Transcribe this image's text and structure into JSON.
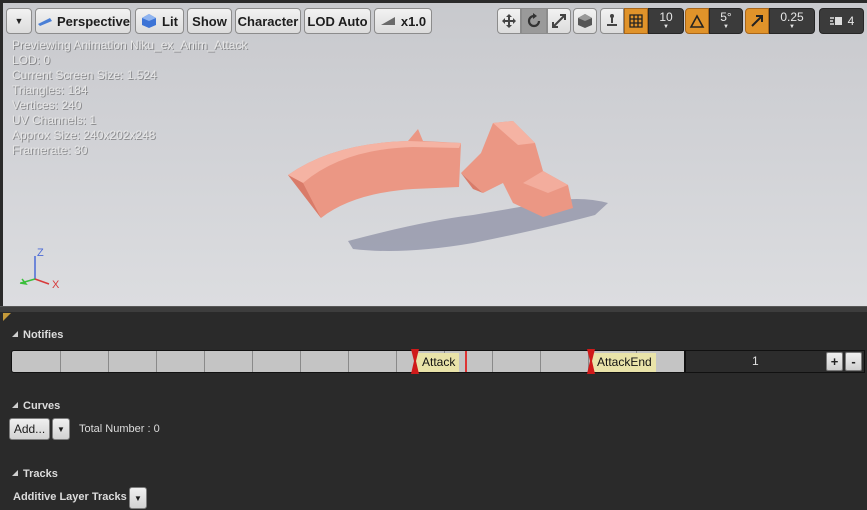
{
  "toolbar": {
    "perspective_label": "Perspective",
    "lit_label": "Lit",
    "show_label": "Show",
    "character_label": "Character",
    "lod_label": "LOD Auto",
    "speed_label": "x1.0",
    "grid_snap_value": "10",
    "rotation_snap_value": "5°",
    "scale_snap_value": "0.25",
    "camera_speed_value": "4"
  },
  "stats": {
    "lines": [
      "Previewing Animation Niku_ex_Anim_Attack",
      "LOD: 0",
      "Current Screen Size: 1.524",
      "Triangles: 184",
      "Vertices: 240",
      "UV Channels: 1",
      "Approx Size: 240x202x248",
      "Framerate: 30"
    ]
  },
  "axis": {
    "z": "Z",
    "x": "X"
  },
  "notifies": {
    "header": "Notifies",
    "events": [
      {
        "label": "Attack"
      },
      {
        "label": "AttackEnd"
      }
    ],
    "track_number": "1",
    "add_label": "+",
    "remove_label": "-"
  },
  "curves": {
    "header": "Curves",
    "add_label": "Add...",
    "total_label": "Total Number : 0"
  },
  "tracks": {
    "header": "Tracks",
    "additive_label": "Additive Layer Tracks"
  },
  "colors": {
    "model": "#f0a08c",
    "accent_orange": "#e0932a",
    "notify_bg": "#e9e3a9",
    "playhead": "#d33333"
  }
}
